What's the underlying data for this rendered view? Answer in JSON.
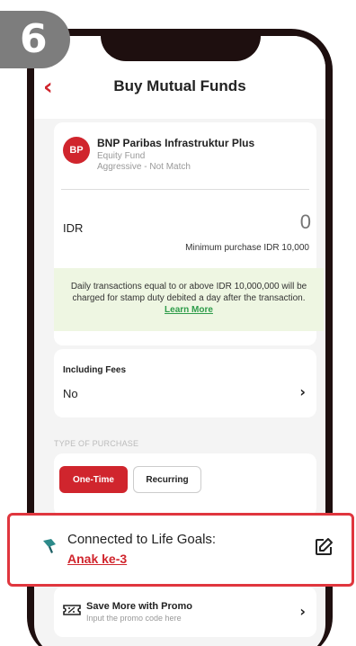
{
  "step": {
    "number": "6"
  },
  "header": {
    "title": "Buy Mutual Funds"
  },
  "fund": {
    "avatar": "BP",
    "name": "BNP Paribas Infrastruktur Plus",
    "type": "Equity Fund",
    "risk": "Aggressive - Not Match"
  },
  "purchase_amount": {
    "currency": "IDR",
    "value": "0",
    "min_purchase": "Minimum purchase IDR 10,000"
  },
  "notice": {
    "text": "Daily transactions equal to or above IDR 10,000,000 will be charged for stamp duty debited a day after the transaction. ",
    "link": "Learn More"
  },
  "fees": {
    "label": "Including Fees",
    "value": "No"
  },
  "purchase_type": {
    "section_label": "TYPE OF PURCHASE",
    "options": [
      "One-Time",
      "Recurring"
    ],
    "selected": "One-Time"
  },
  "life_goals": {
    "label": "Connected to Life Goals:",
    "goal": "Anak ke-3"
  },
  "promo": {
    "title": "Save More with Promo",
    "subtitle": "Input the promo code here"
  },
  "colors": {
    "accent": "#d0252d",
    "notice_bg": "#eef6e2",
    "highlight_border": "#e0363e",
    "phone_frame": "#1e0f0f"
  }
}
